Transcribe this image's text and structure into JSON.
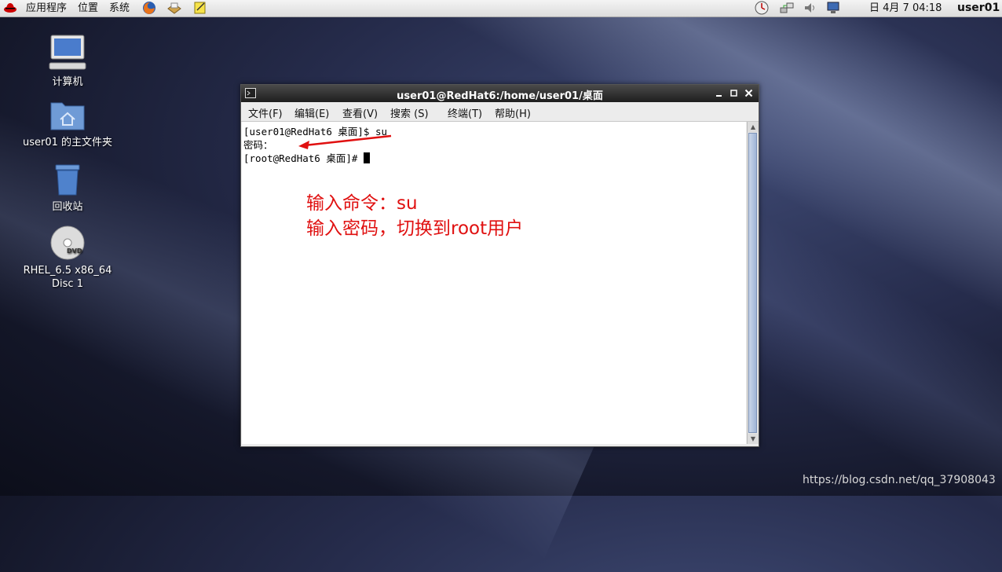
{
  "panel": {
    "menu_apps": "应用程序",
    "menu_places": "位置",
    "menu_system": "系统",
    "datetime": "日 4月   7 04:18",
    "user": "user01",
    "launcher_icons": [
      "redhat-logo-icon",
      "firefox-icon",
      "mail-icon",
      "note-icon"
    ],
    "tray_icons": [
      "clock-icon",
      "network-icon",
      "volume-icon",
      "display-icon"
    ]
  },
  "desktop": {
    "icons": [
      {
        "label": "计算机",
        "icon": "computer-icon"
      },
      {
        "label": "user01 的主文件夹",
        "icon": "home-folder-icon"
      },
      {
        "label": "回收站",
        "icon": "trash-icon"
      },
      {
        "label": "RHEL_6.5 x86_64\nDisc 1",
        "label1": "RHEL_6.5 x86_64",
        "label2": "Disc 1",
        "icon": "dvd-icon"
      }
    ]
  },
  "terminal": {
    "title": "user01@RedHat6:/home/user01/桌面",
    "menu": [
      "文件(F)",
      "编辑(E)",
      "查看(V)",
      "搜索 (S)",
      "终端(T)",
      "帮助(H)"
    ],
    "lines": [
      "[user01@RedHat6 桌面]$ su",
      "密码：",
      "[root@RedHat6 桌面]# "
    ]
  },
  "annotation": {
    "line1": "输入命令：su",
    "line2": "输入密码，切换到root用户",
    "color": "#e01010"
  },
  "watermark": "https://blog.csdn.net/qq_37908043"
}
